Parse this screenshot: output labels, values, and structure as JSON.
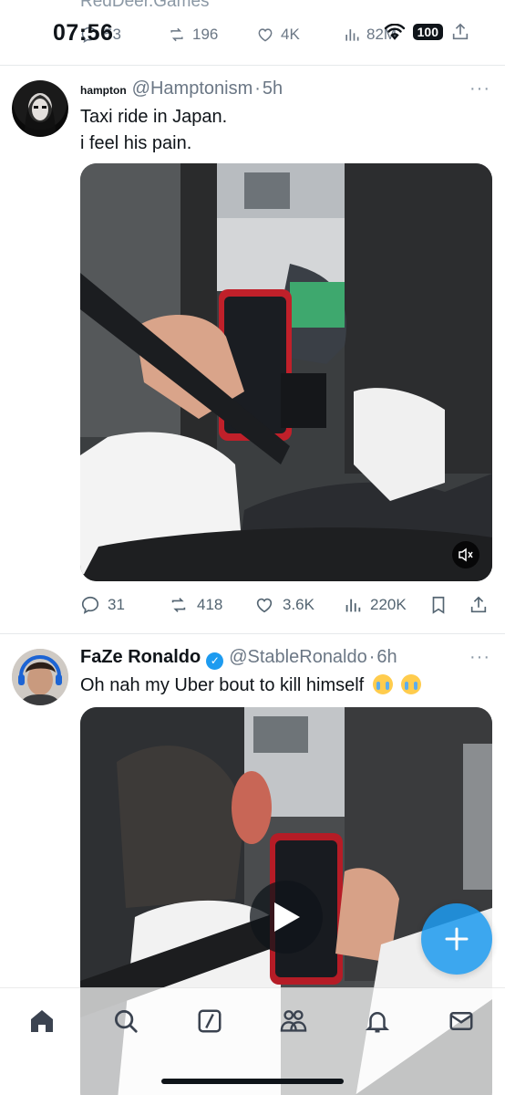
{
  "status_bar": {
    "time": "07:56",
    "battery": "100"
  },
  "previous_tweet": {
    "name_partial": "RedDeer.Games",
    "replies": "53",
    "reposts": "196",
    "likes": "4K",
    "views": "82M"
  },
  "tweets": [
    {
      "name": "hampton",
      "handle": "@Hamptonism",
      "time": "5h",
      "text_lines": [
        "Taxi ride in Japan.",
        "i feel his pain."
      ],
      "replies": "31",
      "reposts": "418",
      "likes": "3.6K",
      "views": "220K"
    },
    {
      "name": "FaZe Ronaldo",
      "handle": "@StableRonaldo",
      "time": "6h",
      "text": "Oh nah my Uber bout to kill himself",
      "verified": true
    }
  ],
  "separator": "·",
  "more_label": "···",
  "nav": [
    "home-icon",
    "search-icon",
    "grok-icon",
    "communities-icon",
    "notifications-icon",
    "messages-icon"
  ],
  "colors": {
    "accent": "#1d9bf0",
    "text": "#0f1419",
    "muted": "#536471"
  }
}
